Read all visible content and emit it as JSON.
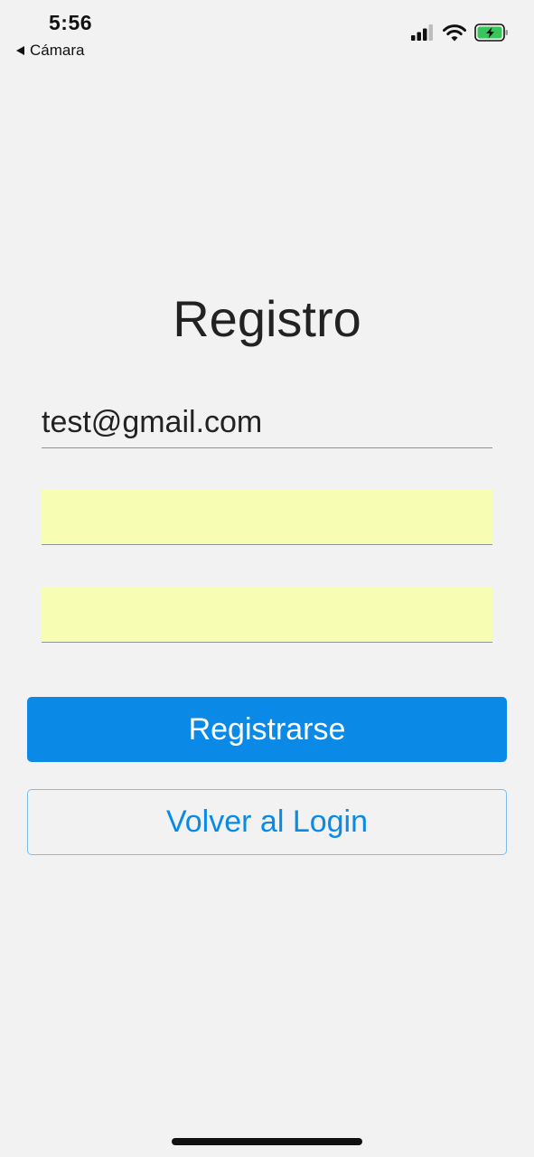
{
  "status_bar": {
    "time": "5:56",
    "back_label": "Cámara",
    "battery_color": "#35c759"
  },
  "register": {
    "title": "Registro",
    "email_value": "test@gmail.com",
    "password_value": "",
    "confirm_password_value": "",
    "autofill_color": "#f8fdb4",
    "submit_label": "Registrarse",
    "back_to_login_label": "Volver al Login",
    "accent_color": "#0a8ae6"
  }
}
